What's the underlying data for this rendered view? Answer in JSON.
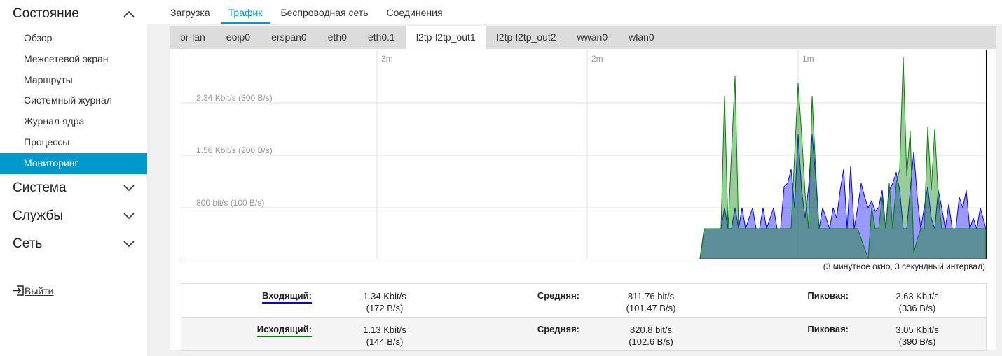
{
  "sidebar": {
    "status_title": "Состояние",
    "status_items": [
      {
        "label": "Обзор"
      },
      {
        "label": "Межсетевой экран"
      },
      {
        "label": "Маршруты"
      },
      {
        "label": "Системный журнал"
      },
      {
        "label": "Журнал ядра"
      },
      {
        "label": "Процессы"
      },
      {
        "label": "Мониторинг"
      }
    ],
    "system_title": "Система",
    "services_title": "Службы",
    "network_title": "Сеть",
    "logout_label": "Выйти"
  },
  "top_tabs": [
    {
      "label": "Загрузка"
    },
    {
      "label": "Трафик"
    },
    {
      "label": "Беспроводная сеть"
    },
    {
      "label": "Соединения"
    }
  ],
  "interface_tabs": [
    {
      "label": "br-lan"
    },
    {
      "label": "eoip0"
    },
    {
      "label": "erspan0"
    },
    {
      "label": "eth0"
    },
    {
      "label": "eth0.1"
    },
    {
      "label": "l2tp-l2tp_out1"
    },
    {
      "label": "l2tp-l2tp_out2"
    },
    {
      "label": "wwan0"
    },
    {
      "label": "wlan0"
    }
  ],
  "graph": {
    "time_labels": [
      "3m",
      "2m",
      "1m"
    ],
    "y_labels": [
      "2.34 Kbit/s (300 B/s)",
      "1.56 Kbit/s (200 B/s)",
      "800 bit/s (100 B/s)"
    ],
    "caption": "(3 минутное окно, 3 секундный интервал)",
    "colors": {
      "inbound": "#0000ff",
      "outbound": "#008000"
    }
  },
  "stats": {
    "inbound": {
      "label": "Входящий:",
      "current": "1.34 Kbit/s",
      "current_bytes": "(172 B/s)",
      "avg_label": "Средняя:",
      "avg": "811.76 bit/s",
      "avg_bytes": "(101.47 B/s)",
      "peak_label": "Пиковая:",
      "peak": "2.63 Kbit/s",
      "peak_bytes": "(336 B/s)"
    },
    "outbound": {
      "label": "Исходящий:",
      "current": "1.13 Kbit/s",
      "current_bytes": "(144 B/s)",
      "avg_label": "Средняя:",
      "avg": "820.8 bit/s",
      "avg_bytes": "(102.6 B/s)",
      "peak_label": "Пиковая:",
      "peak": "3.05 Kbit/s",
      "peak_bytes": "(390 B/s)"
    }
  }
}
